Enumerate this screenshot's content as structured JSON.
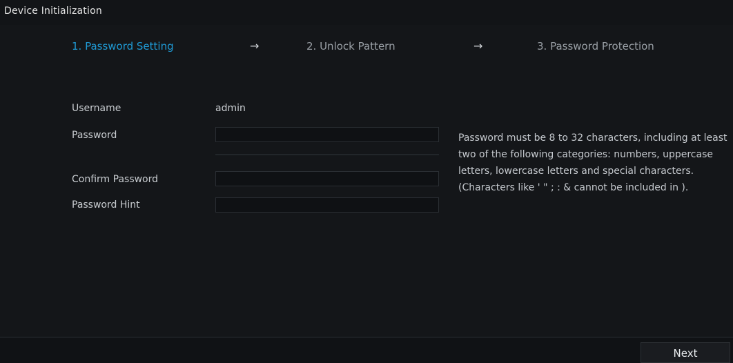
{
  "window": {
    "title": "Device Initialization"
  },
  "steps": [
    {
      "label": "1. Password Setting",
      "active": true
    },
    {
      "label": "2. Unlock Pattern",
      "active": false
    },
    {
      "label": "3. Password Protection",
      "active": false
    }
  ],
  "arrows": [
    "→",
    "→"
  ],
  "form": {
    "username_label": "Username",
    "username_value": "admin",
    "password_label": "Password",
    "password_value": "",
    "confirm_label": "Confirm Password",
    "confirm_value": "",
    "hint_label": "Password Hint",
    "hint_value": ""
  },
  "rules": "Password must be 8 to 32 characters, including at least two of the following categories: numbers, uppercase letters, lowercase letters and special characters. (Characters like ' \" ; : & cannot be included in ).",
  "footer": {
    "next_label": "Next"
  },
  "colors": {
    "active_step": "#1f9bd6",
    "background": "#141619"
  }
}
